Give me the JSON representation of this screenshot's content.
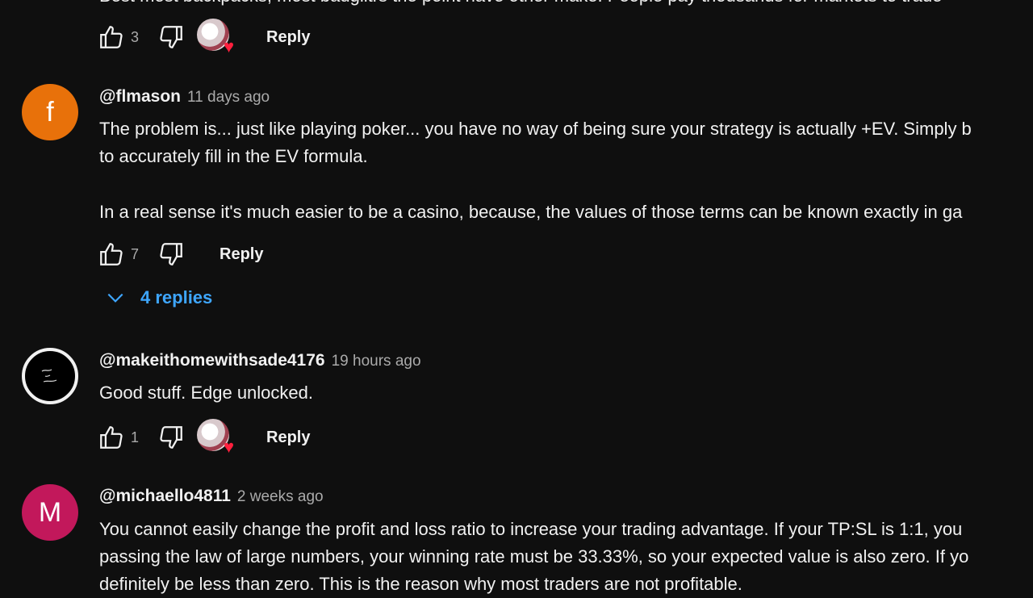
{
  "comments": [
    {
      "text_lines": [
        "Best most backpacks, most bauglitrs the point have other make. People pay thousands for markets to trade"
      ],
      "likes": "3",
      "reply_label": "Reply"
    },
    {
      "avatar_letter": "f",
      "avatar_color": "#e8710a",
      "handle": "@flmason",
      "time": "11 days ago",
      "text_lines": [
        "The problem is... just like playing poker... you have no way of being sure your strategy is actually +EV. Simply b",
        "to accurately fill in the EV formula.",
        "In a real sense it's much easier to be a casino, because, the values of those terms can be known exactly in ga"
      ],
      "likes": "7",
      "reply_label": "Reply",
      "replies_label": "4 replies"
    },
    {
      "avatar_letter": "",
      "avatar_color": "#000000",
      "handle": "@makeithomewithsade4176",
      "time": "19 hours ago",
      "text_lines": [
        "Good stuff. Edge unlocked."
      ],
      "likes": "1",
      "reply_label": "Reply"
    },
    {
      "avatar_letter": "M",
      "avatar_color": "#c2185b",
      "handle": "@michaello4811",
      "time": "2 weeks ago",
      "text_lines": [
        "You cannot easily change the profit and loss ratio to increase your trading advantage. If your TP:SL is 1:1, you",
        "passing the law of large numbers, your winning rate must be 33.33%, so your expected value is also zero. If yo",
        "definitely be less than zero. This is the reason why most traders are not profitable."
      ]
    }
  ],
  "icons": {
    "like": "thumbs-up-icon",
    "dislike": "thumbs-down-icon",
    "creator_heart": "creator-heart-icon",
    "expand": "chevron-down-icon"
  },
  "colors": {
    "background": "#0f0f0f",
    "link_blue": "#3ea6ff",
    "muted": "#aaaaaa"
  }
}
